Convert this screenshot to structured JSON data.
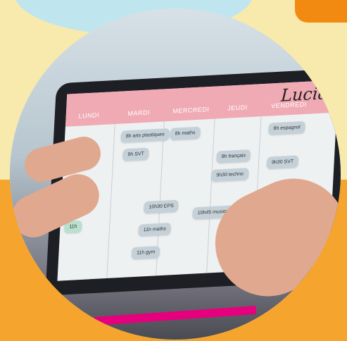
{
  "schedule": {
    "brand": "Lucia",
    "days": [
      "LUNDI",
      "MARDI",
      "MERCREDI",
      "JEUDI",
      "VENDREDI"
    ],
    "events": [
      {
        "label": "8h arts plastiques",
        "day": 1
      },
      {
        "label": "8h maths",
        "day": 2
      },
      {
        "label": "8h espagnol",
        "day": 4
      },
      {
        "label": "9h SVT",
        "day": 1
      },
      {
        "label": "8h français",
        "day": 3
      },
      {
        "label": "9h30 SVT",
        "day": 4
      },
      {
        "label": "9h30 techno",
        "day": 3
      },
      {
        "label": "10h30 EPS",
        "day": 1
      },
      {
        "label": "10h45 musique",
        "day": 2
      },
      {
        "label": "11h maths",
        "day": 1
      },
      {
        "label": "11h",
        "day": 0
      },
      {
        "label": "11h gym",
        "day": 1
      }
    ]
  }
}
